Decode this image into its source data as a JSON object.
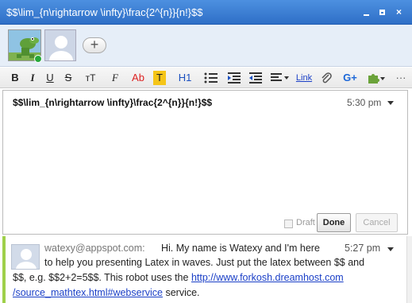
{
  "window": {
    "title": "$$\\lim_{n\\rightarrow \\infty}\\frac{2^{n}}{n!}$$",
    "close_glyph": "×"
  },
  "participants": {
    "add_glyph": "+"
  },
  "toolbar": {
    "bold": "B",
    "italic": "I",
    "underline": "U",
    "strike": "S",
    "size": "тT",
    "font": "F",
    "color": "Ab",
    "highlight": "T",
    "heading": "H1",
    "link": "Link",
    "plus": "G+",
    "more": "···"
  },
  "editor": {
    "text": "$$\\lim_{n\\rightarrow \\infty}\\frac{2^{n}}{n!}$$",
    "time": "5:30 pm",
    "draft_label": "Draft",
    "done_label": "Done",
    "cancel_label": "Cancel"
  },
  "reply": {
    "author": "watexy@appspot.com:",
    "first_line": "Hi. My name is Watexy and I'm here",
    "time": "5:27 pm",
    "line2": "to help you presenting Latex in waves. Just put the latex between $$ and",
    "line3_pre": "$$, e.g. $$2+2=5$$. This robot uses the ",
    "link1": "http://www.forkosh.dreamhost.com",
    "line4_link": "/source_mathtex.html#webservice",
    "line4_post": " service."
  }
}
